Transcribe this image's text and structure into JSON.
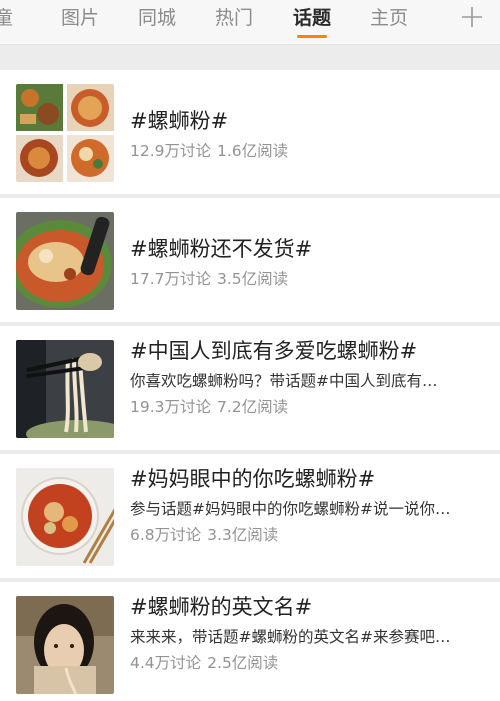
{
  "tabs": [
    {
      "label": "童"
    },
    {
      "label": "图片"
    },
    {
      "label": "同城"
    },
    {
      "label": "热门"
    },
    {
      "label": "话题"
    },
    {
      "label": "主页"
    }
  ],
  "active_tab": "话题",
  "colors": {
    "accent": "#ff8200",
    "tab_inactive": "#8c8c8c",
    "title_text": "#222222",
    "stats_text": "#939393"
  },
  "topics": [
    {
      "title": "#螺蛳粉#",
      "desc": "",
      "discussions": "12.9万讨论",
      "reads": "1.6亿阅读"
    },
    {
      "title": "#螺蛳粉还不发货#",
      "desc": "",
      "discussions": "17.7万讨论",
      "reads": "3.5亿阅读"
    },
    {
      "title": "#中国人到底有多爱吃螺蛳粉#",
      "desc": "你喜欢吃螺蛳粉吗？带话题#中国人到底有…",
      "discussions": "19.3万讨论",
      "reads": "7.2亿阅读"
    },
    {
      "title": "#妈妈眼中的你吃螺蛳粉#",
      "desc": "参与话题#妈妈眼中的你吃螺蛳粉#说一说你…",
      "discussions": "6.8万讨论",
      "reads": "3.3亿阅读"
    },
    {
      "title": "#螺蛳粉的英文名#",
      "desc": "来来来，带话题#螺蛳粉的英文名#来参赛吧…",
      "discussions": "4.4万讨论",
      "reads": "2.5亿阅读"
    }
  ],
  "icons": {
    "add": "plus-icon"
  }
}
